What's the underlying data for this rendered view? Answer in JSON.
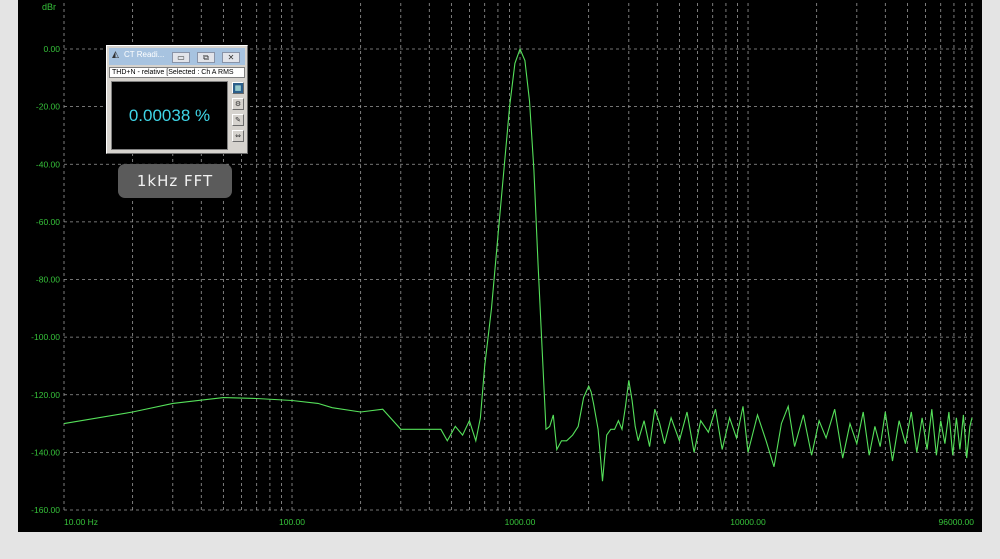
{
  "readout": {
    "title": "CT Readi...",
    "subtitle": "THD+N - relative [Selected : Ch A RMS",
    "value": "0.00038 %",
    "buttons": {
      "minimize": "▭",
      "restore": "⧉",
      "close": "✕"
    }
  },
  "badge": {
    "label": "1kHz  FFT"
  },
  "colors": {
    "trace": "#55e05a",
    "axis_text": "#36c23a",
    "grid": "#9a9a9a",
    "background": "#000000"
  },
  "chart_data": {
    "type": "line",
    "title": "",
    "xlabel": "",
    "ylabel": "dBr",
    "x_scale": "log",
    "xlim": [
      10,
      96000
    ],
    "ylim": [
      -160,
      0
    ],
    "grid": true,
    "y_ticks": [
      0,
      -20,
      -40,
      -60,
      -80,
      -100,
      -120,
      -140,
      -160
    ],
    "y_tick_labels": [
      "0.00",
      "-20.00",
      "-40.00",
      "-60.00",
      "-80.00",
      "-100.00",
      "-120.00",
      "-140.00",
      "-160.00"
    ],
    "x_tick_labels": [
      {
        "value": 10,
        "label": "10.00 Hz"
      },
      {
        "value": 100,
        "label": "100.00"
      },
      {
        "value": 1000,
        "label": "1000.00"
      },
      {
        "value": 10000,
        "label": "10000.00"
      },
      {
        "value": 96000,
        "label": "96000.00"
      }
    ],
    "series": [
      {
        "points": [
          [
            10,
            -130
          ],
          [
            20,
            -126
          ],
          [
            30,
            -123
          ],
          [
            50,
            -121
          ],
          [
            70,
            -121.3
          ],
          [
            100,
            -122
          ],
          [
            130,
            -123
          ],
          [
            150,
            -124.5
          ],
          [
            200,
            -126
          ],
          [
            250,
            -125
          ],
          [
            300,
            -132
          ],
          [
            400,
            -132
          ],
          [
            450,
            -132
          ],
          [
            480,
            -136
          ],
          [
            520,
            -131
          ],
          [
            560,
            -134
          ],
          [
            600,
            -129
          ],
          [
            640,
            -136
          ],
          [
            670,
            -128
          ],
          [
            700,
            -110
          ],
          [
            750,
            -90
          ],
          [
            800,
            -65
          ],
          [
            850,
            -42
          ],
          [
            900,
            -20
          ],
          [
            950,
            -5
          ],
          [
            1000,
            0
          ],
          [
            1050,
            -4
          ],
          [
            1100,
            -18
          ],
          [
            1150,
            -42
          ],
          [
            1200,
            -75
          ],
          [
            1250,
            -104
          ],
          [
            1300,
            -132
          ],
          [
            1350,
            -131
          ],
          [
            1400,
            -127
          ],
          [
            1450,
            -139
          ],
          [
            1520,
            -136
          ],
          [
            1600,
            -136
          ],
          [
            1700,
            -134
          ],
          [
            1800,
            -131
          ],
          [
            1900,
            -121
          ],
          [
            2000,
            -117
          ],
          [
            2050,
            -119
          ],
          [
            2100,
            -123
          ],
          [
            2200,
            -132
          ],
          [
            2300,
            -150
          ],
          [
            2400,
            -134
          ],
          [
            2500,
            -132
          ],
          [
            2600,
            -132
          ],
          [
            2700,
            -129
          ],
          [
            2800,
            -132
          ],
          [
            2900,
            -124
          ],
          [
            3000,
            -115
          ],
          [
            3100,
            -122
          ],
          [
            3200,
            -131
          ],
          [
            3300,
            -136
          ],
          [
            3500,
            -129
          ],
          [
            3700,
            -138
          ],
          [
            3900,
            -125
          ],
          [
            4100,
            -130
          ],
          [
            4300,
            -137
          ],
          [
            4600,
            -128
          ],
          [
            5000,
            -136
          ],
          [
            5400,
            -126
          ],
          [
            5800,
            -140
          ],
          [
            6200,
            -129
          ],
          [
            6700,
            -133
          ],
          [
            7200,
            -125
          ],
          [
            7700,
            -139
          ],
          [
            8300,
            -128
          ],
          [
            8900,
            -135
          ],
          [
            9500,
            -124
          ],
          [
            10000,
            -140
          ],
          [
            11000,
            -127
          ],
          [
            12000,
            -136
          ],
          [
            13000,
            -145
          ],
          [
            14000,
            -130
          ],
          [
            15000,
            -124
          ],
          [
            16000,
            -138
          ],
          [
            17500,
            -127
          ],
          [
            19000,
            -141
          ],
          [
            20500,
            -129
          ],
          [
            22000,
            -135
          ],
          [
            24000,
            -125
          ],
          [
            26000,
            -142
          ],
          [
            28000,
            -130
          ],
          [
            30000,
            -137
          ],
          [
            32000,
            -126
          ],
          [
            34000,
            -141
          ],
          [
            36000,
            -131
          ],
          [
            38000,
            -138
          ],
          [
            40000,
            -126
          ],
          [
            43000,
            -143
          ],
          [
            46000,
            -129
          ],
          [
            49000,
            -137
          ],
          [
            52000,
            -126
          ],
          [
            55000,
            -140
          ],
          [
            58000,
            -128
          ],
          [
            61000,
            -139
          ],
          [
            64000,
            -125
          ],
          [
            67000,
            -141
          ],
          [
            70000,
            -129
          ],
          [
            73000,
            -137
          ],
          [
            76000,
            -126
          ],
          [
            79000,
            -141
          ],
          [
            82000,
            -128
          ],
          [
            85000,
            -139
          ],
          [
            88000,
            -127
          ],
          [
            91000,
            -142
          ],
          [
            94000,
            -131
          ],
          [
            96000,
            -128
          ]
        ]
      }
    ]
  }
}
